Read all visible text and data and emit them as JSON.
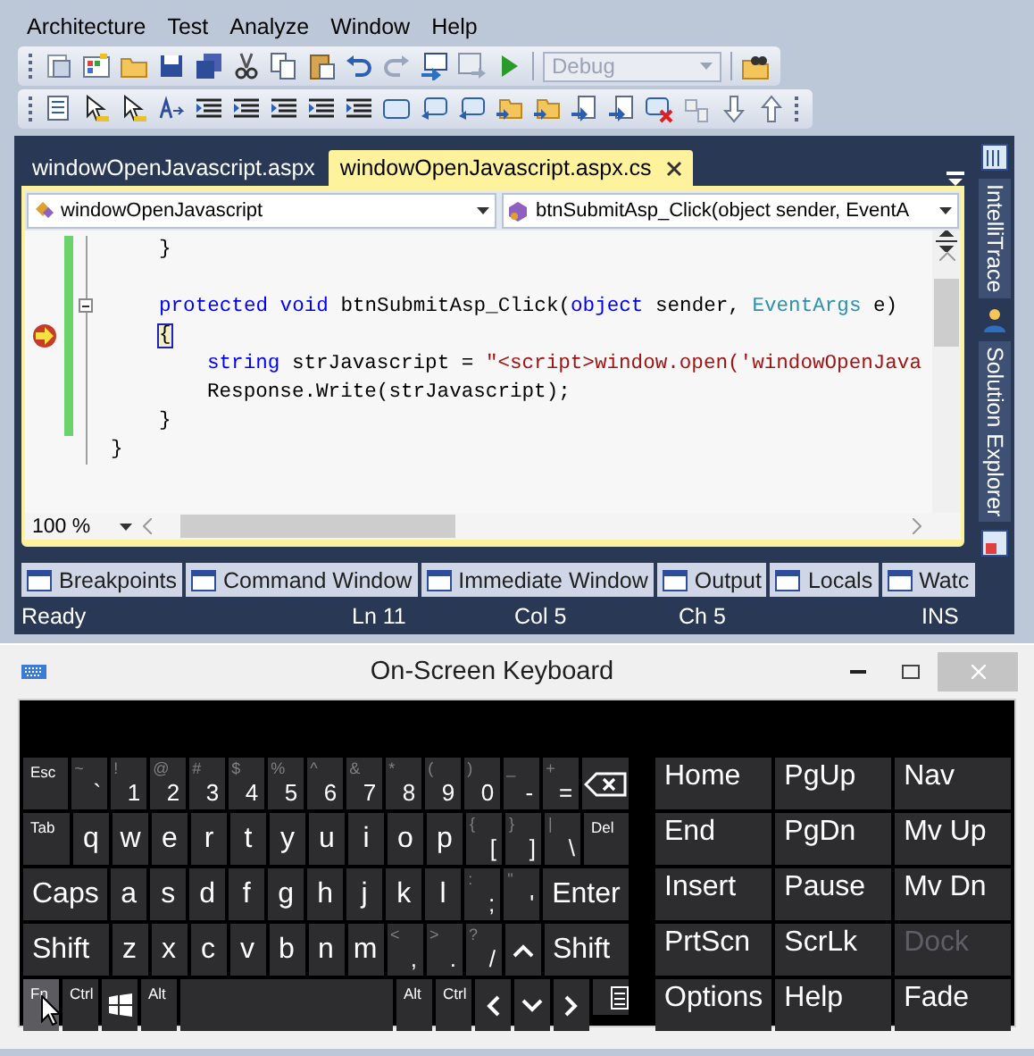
{
  "menu": [
    "Architecture",
    "Test",
    "Analyze",
    "Window",
    "Help"
  ],
  "toolbar": {
    "configuration": "Debug"
  },
  "document_tabs": [
    {
      "label": "windowOpenJavascript.aspx",
      "selected": false
    },
    {
      "label": "windowOpenJavascript.aspx.cs",
      "selected": true
    }
  ],
  "editor": {
    "type_dropdown": "windowOpenJavascript",
    "member_dropdown": "btnSubmitAsp_Click(object sender, EventA",
    "zoom": "100 %",
    "lines": [
      {
        "changed": true,
        "collapsible": false,
        "current": false,
        "tokens": [
          {
            "kind": "indent"
          },
          {
            "kind": "plain",
            "text": "}"
          }
        ]
      },
      {
        "changed": true,
        "collapsible": false,
        "current": false
      },
      {
        "changed": true,
        "collapsible": true,
        "current": false,
        "tokens": [
          {
            "kind": "indent"
          },
          {
            "kind": "keyword",
            "text": "protected"
          },
          {
            "kind": "keyword",
            "text": " void"
          },
          {
            "kind": "plain",
            "text": " btnSubmitAsp_Click("
          },
          {
            "kind": "keyword",
            "text": "object"
          },
          {
            "kind": "plain",
            "text": " sender, "
          },
          {
            "kind": "type",
            "text": "EventArgs"
          },
          {
            "kind": "plain",
            "text": " e)"
          }
        ]
      },
      {
        "changed": true,
        "collapsible": false,
        "current": true,
        "tokens": [
          {
            "kind": "indent"
          },
          {
            "kind": "brace_match",
            "text": "{"
          }
        ]
      },
      {
        "changed": true,
        "collapsible": false,
        "current": false,
        "tokens": [
          {
            "kind": "indent"
          },
          {
            "kind": "indent"
          },
          {
            "kind": "keyword",
            "text": "string"
          },
          {
            "kind": "plain",
            "text": " strJavascript = "
          },
          {
            "kind": "string",
            "text": "\"<script>window.open('windowOpenJava"
          }
        ]
      },
      {
        "changed": true,
        "collapsible": false,
        "current": false,
        "tokens": [
          {
            "kind": "indent"
          },
          {
            "kind": "indent"
          },
          {
            "kind": "plain",
            "text": "Response.Write(strJavascript);"
          }
        ]
      },
      {
        "changed": true,
        "collapsible": false,
        "current": false,
        "tokens": [
          {
            "kind": "indent"
          },
          {
            "kind": "plain",
            "text": "}"
          }
        ]
      },
      {
        "changed": false,
        "collapsible": false,
        "current": false,
        "tokens": [
          {
            "kind": "plain",
            "text": "}"
          }
        ]
      }
    ]
  },
  "side_tabs": [
    "IntelliTrace",
    "Solution Explorer"
  ],
  "tool_tabs": [
    "Breakpoints",
    "Command Window",
    "Immediate Window",
    "Output",
    "Locals",
    "Watc"
  ],
  "status_bar": {
    "state": "Ready",
    "line": "Ln 11",
    "column": "Col 5",
    "char": "Ch 5",
    "mode": "INS"
  },
  "osk": {
    "title": "On-Screen Keyboard",
    "rows": [
      {
        "keys": [
          {
            "kind": "mod",
            "label": "Esc",
            "pressed": false
          },
          {
            "kind": "char",
            "label": "`",
            "shift": "~",
            "pressed": false
          },
          {
            "kind": "char",
            "label": "1",
            "shift": "!",
            "pressed": false
          },
          {
            "kind": "char",
            "label": "2",
            "shift": "@",
            "pressed": false
          },
          {
            "kind": "char",
            "label": "3",
            "shift": "#",
            "pressed": false
          },
          {
            "kind": "char",
            "label": "4",
            "shift": "$",
            "pressed": false
          },
          {
            "kind": "char",
            "label": "5",
            "shift": "%",
            "pressed": false
          },
          {
            "kind": "char",
            "label": "6",
            "shift": "^",
            "pressed": false
          },
          {
            "kind": "char",
            "label": "7",
            "shift": "&",
            "pressed": false
          },
          {
            "kind": "char",
            "label": "8",
            "shift": "*",
            "pressed": false
          },
          {
            "kind": "char",
            "label": "9",
            "shift": "(",
            "pressed": false
          },
          {
            "kind": "char",
            "label": "0",
            "shift": ")",
            "pressed": false
          },
          {
            "kind": "char",
            "label": "-",
            "shift": "_",
            "pressed": false
          },
          {
            "kind": "char",
            "label": "=",
            "shift": "+",
            "pressed": false
          },
          {
            "kind": "backspace",
            "pressed": false
          }
        ]
      },
      {
        "keys": [
          {
            "kind": "mod",
            "label": "Tab",
            "pressed": false
          },
          {
            "kind": "char",
            "label": "q",
            "pressed": false
          },
          {
            "kind": "char",
            "label": "w",
            "pressed": false
          },
          {
            "kind": "char",
            "label": "e",
            "pressed": false
          },
          {
            "kind": "char",
            "label": "r",
            "pressed": false
          },
          {
            "kind": "char",
            "label": "t",
            "pressed": false
          },
          {
            "kind": "char",
            "label": "y",
            "pressed": false
          },
          {
            "kind": "char",
            "label": "u",
            "pressed": false
          },
          {
            "kind": "char",
            "label": "i",
            "pressed": false
          },
          {
            "kind": "char",
            "label": "o",
            "pressed": false
          },
          {
            "kind": "char",
            "label": "p",
            "pressed": false
          },
          {
            "kind": "char",
            "label": "[",
            "shift": "{",
            "pressed": false
          },
          {
            "kind": "char",
            "label": "]",
            "shift": "}",
            "pressed": false
          },
          {
            "kind": "char",
            "label": "\\",
            "shift": "|",
            "pressed": false
          },
          {
            "kind": "mod",
            "label": "Del",
            "pressed": false
          }
        ]
      },
      {
        "keys": [
          {
            "kind": "big",
            "label": "Caps",
            "pressed": false
          },
          {
            "kind": "char",
            "label": "a",
            "pressed": false
          },
          {
            "kind": "char",
            "label": "s",
            "pressed": false
          },
          {
            "kind": "char",
            "label": "d",
            "pressed": false
          },
          {
            "kind": "char",
            "label": "f",
            "pressed": false
          },
          {
            "kind": "char",
            "label": "g",
            "pressed": false
          },
          {
            "kind": "char",
            "label": "h",
            "pressed": false
          },
          {
            "kind": "char",
            "label": "j",
            "pressed": false
          },
          {
            "kind": "char",
            "label": "k",
            "pressed": false
          },
          {
            "kind": "char",
            "label": "l",
            "pressed": false
          },
          {
            "kind": "char",
            "label": ";",
            "shift": ":",
            "pressed": false
          },
          {
            "kind": "char",
            "label": "'",
            "shift": "\"",
            "pressed": false
          },
          {
            "kind": "big",
            "label": "Enter",
            "pressed": false
          }
        ]
      },
      {
        "keys": [
          {
            "kind": "big",
            "label": "Shift",
            "pressed": false
          },
          {
            "kind": "char",
            "label": "z",
            "pressed": false
          },
          {
            "kind": "char",
            "label": "x",
            "pressed": false
          },
          {
            "kind": "char",
            "label": "c",
            "pressed": false
          },
          {
            "kind": "char",
            "label": "v",
            "pressed": false
          },
          {
            "kind": "char",
            "label": "b",
            "pressed": false
          },
          {
            "kind": "char",
            "label": "n",
            "pressed": false
          },
          {
            "kind": "char",
            "label": "m",
            "pressed": false
          },
          {
            "kind": "char",
            "label": ",",
            "shift": "<",
            "pressed": false
          },
          {
            "kind": "char",
            "label": ".",
            "shift": ">",
            "pressed": false
          },
          {
            "kind": "char",
            "label": "/",
            "shift": "?",
            "pressed": false
          },
          {
            "kind": "up",
            "pressed": false
          },
          {
            "kind": "big",
            "label": "Shift",
            "pressed": false
          }
        ]
      },
      {
        "keys": [
          {
            "kind": "mod",
            "label": "Fn",
            "pressed": true
          },
          {
            "kind": "mod",
            "label": "Ctrl",
            "pressed": false
          },
          {
            "kind": "windows",
            "pressed": false
          },
          {
            "kind": "mod",
            "label": "Alt",
            "pressed": false
          },
          {
            "kind": "space",
            "pressed": false
          },
          {
            "kind": "mod",
            "label": "Alt",
            "pressed": false
          },
          {
            "kind": "mod",
            "label": "Ctrl",
            "pressed": false
          },
          {
            "kind": "left",
            "pressed": false
          },
          {
            "kind": "down",
            "pressed": false
          },
          {
            "kind": "right",
            "pressed": false
          },
          {
            "kind": "menu",
            "pressed": false
          }
        ]
      }
    ],
    "nav_keys": [
      {
        "label": "Home",
        "disabled": false
      },
      {
        "label": "PgUp",
        "disabled": false
      },
      {
        "label": "Nav",
        "disabled": false
      },
      {
        "label": "End",
        "disabled": false
      },
      {
        "label": "PgDn",
        "disabled": false
      },
      {
        "label": "Mv Up",
        "disabled": false
      },
      {
        "label": "Insert",
        "disabled": false
      },
      {
        "label": "Pause",
        "disabled": false
      },
      {
        "label": "Mv Dn",
        "disabled": false
      },
      {
        "label": "PrtScn",
        "disabled": false
      },
      {
        "label": "ScrLk",
        "disabled": false
      },
      {
        "label": "Dock",
        "disabled": true
      },
      {
        "label": "Options",
        "disabled": false
      },
      {
        "label": "Help",
        "disabled": false
      },
      {
        "label": "Fade",
        "disabled": false
      }
    ]
  }
}
